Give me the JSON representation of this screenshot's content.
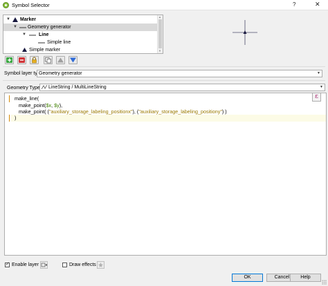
{
  "window": {
    "title": "Symbol Selector",
    "help_label": "?",
    "close_label": "✕"
  },
  "symbol_tree": {
    "items": [
      {
        "label": "Marker",
        "level": 0,
        "bold": true,
        "icon": "marker-triangle-icon"
      },
      {
        "label": "Geometry generator",
        "level": 1,
        "selected": true,
        "icon": "geometry-generator-icon"
      },
      {
        "label": "Line",
        "level": 2,
        "bold": true,
        "icon": "line-symbol-icon"
      },
      {
        "label": "Simple line",
        "level": 3,
        "icon": "simple-line-icon"
      },
      {
        "label": "Simple marker",
        "level": 1,
        "icon": "simple-marker-triangle-icon"
      }
    ]
  },
  "toolbar": {
    "buttons": [
      {
        "name": "add-layer",
        "icon": "plus-icon",
        "color": "#2e9a35"
      },
      {
        "name": "remove-layer",
        "icon": "minus-icon",
        "color": "#d13438"
      },
      {
        "name": "lock-layer",
        "icon": "lock-icon",
        "color": "#e0a020"
      },
      {
        "name": "duplicate-layer",
        "icon": "duplicate-icon",
        "color": "#6a6a6a"
      },
      {
        "name": "move-up",
        "icon": "arrow-up-icon",
        "color": "#9a9a9a"
      },
      {
        "name": "move-down",
        "icon": "arrow-down-icon",
        "color": "#2f6bd6"
      }
    ]
  },
  "layer_type": {
    "label": "Symbol layer type",
    "value": "Geometry generator"
  },
  "geometry_type": {
    "label": "Geometry Type",
    "value": "LineString / MultiLineString"
  },
  "expression": {
    "line1": "make_line(",
    "line2_a": "make_point(",
    "line2_b": "$x",
    "line2_c": ", ",
    "line2_d": "$y",
    "line2_e": "),",
    "line3_a": "make_point( (",
    "line3_b": "\"auxiliary_storage_labeling_positionx\"",
    "line3_c": "), (",
    "line3_d": "\"auxiliary_storage_labeling_positiony\"",
    "line3_e": ") )",
    "line4": ")"
  },
  "options": {
    "enable_layer_label": "Enable layer",
    "enable_layer_checked": true,
    "draw_effects_label": "Draw effects",
    "draw_effects_checked": false
  },
  "buttons": {
    "ok": "OK",
    "cancel": "Cancel",
    "help": "Help"
  },
  "colors": {
    "selection": "#d9d9d9",
    "current_line": "#fcfbe6",
    "field_string": "#9b7a00",
    "variable": "#3f7f00",
    "default_button_border": "#0078d7"
  }
}
